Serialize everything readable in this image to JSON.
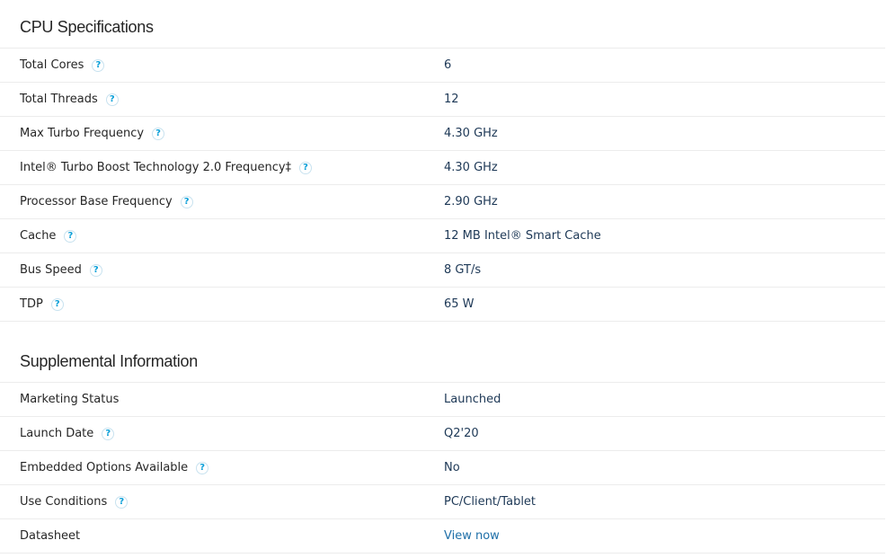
{
  "cpu_specs": {
    "title": "CPU Specifications",
    "rows": [
      {
        "label": "Total Cores",
        "value": "6",
        "help": true
      },
      {
        "label": "Total Threads",
        "value": "12",
        "help": true
      },
      {
        "label": "Max Turbo Frequency",
        "value": "4.30 GHz",
        "help": true
      },
      {
        "label": "Intel® Turbo Boost Technology 2.0 Frequency‡",
        "value": "4.30 GHz",
        "help": true
      },
      {
        "label": "Processor Base Frequency",
        "value": "2.90 GHz",
        "help": true
      },
      {
        "label": "Cache",
        "value": "12 MB Intel® Smart Cache",
        "help": true
      },
      {
        "label": "Bus Speed",
        "value": "8 GT/s",
        "help": true
      },
      {
        "label": "TDP",
        "value": "65 W",
        "help": true
      }
    ]
  },
  "supplemental": {
    "title": "Supplemental Information",
    "rows": [
      {
        "label": "Marketing Status",
        "value": "Launched",
        "help": false
      },
      {
        "label": "Launch Date",
        "value": "Q2'20",
        "help": true
      },
      {
        "label": "Embedded Options Available",
        "value": "No",
        "help": true
      },
      {
        "label": "Use Conditions",
        "value": "PC/Client/Tablet",
        "help": true
      },
      {
        "label": "Datasheet",
        "value": "View now",
        "help": false,
        "link": true
      }
    ]
  },
  "help_icon_glyph": "?",
  "colors": {
    "label_text": "#262626",
    "value_text": "#1d3856",
    "link": "#1e6fa8",
    "help_icon": "#0a9fd8",
    "divider": "#ececec"
  }
}
